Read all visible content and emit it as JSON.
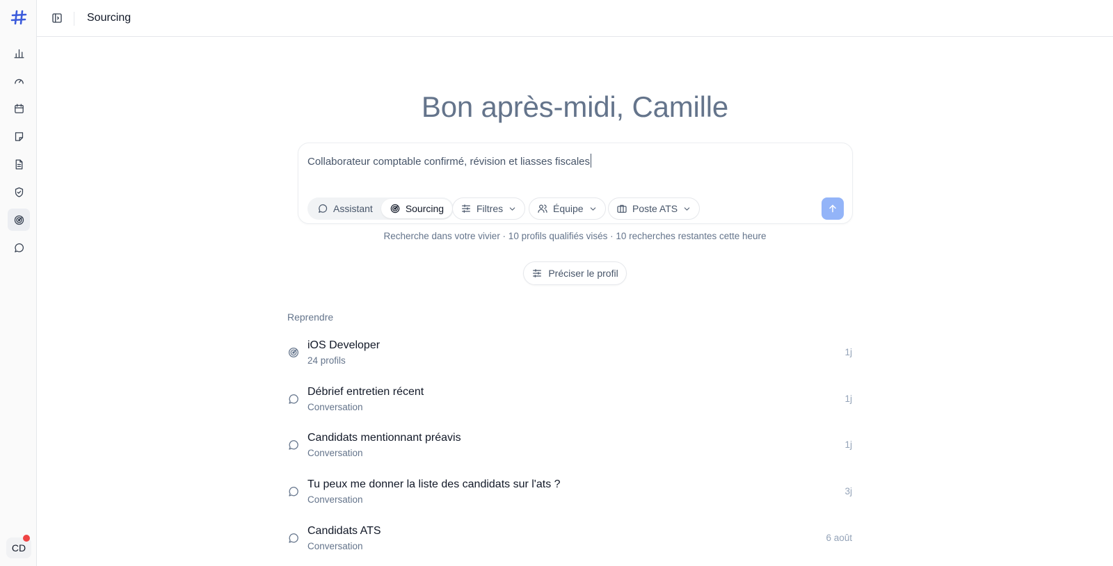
{
  "sidebar": {
    "logo": "hashtag-logo",
    "items": [
      {
        "name": "analytics",
        "icon": "bar-chart-icon"
      },
      {
        "name": "dashboard",
        "icon": "gauge-icon"
      },
      {
        "name": "calendar",
        "icon": "calendar-icon"
      },
      {
        "name": "notes",
        "icon": "sticky-note-icon"
      },
      {
        "name": "documents",
        "icon": "file-text-icon"
      },
      {
        "name": "security",
        "icon": "shield-check-icon"
      },
      {
        "name": "sourcing",
        "icon": "radar-icon",
        "active": true
      },
      {
        "name": "conversations",
        "icon": "message-circle-icon"
      }
    ],
    "user_initials": "CD",
    "notification_color": "#ef4444"
  },
  "header": {
    "title": "Sourcing"
  },
  "main": {
    "greeting": "Bon après-midi, Camille",
    "composer": {
      "query": "Collaborateur comptable confirmé, révision et liasses fiscales",
      "modes": [
        {
          "label": "Assistant",
          "icon": "message-circle-icon",
          "active": false
        },
        {
          "label": "Sourcing",
          "icon": "radar-icon",
          "active": true
        }
      ],
      "filters_label": "Filtres",
      "team_label": "Équipe",
      "ats_label": "Poste ATS",
      "send_color": "#93b4f8"
    },
    "info_line": "Recherche dans votre vivier · 10 profils qualifiés visés · 10 recherches restantes cette heure",
    "refine_label": "Préciser le profil",
    "recent_label": "Reprendre",
    "recent": [
      {
        "title": "iOS Developer",
        "subtitle": "24 profils",
        "time": "1j",
        "icon": "radar-icon"
      },
      {
        "title": "Débrief entretien récent",
        "subtitle": "Conversation",
        "time": "1j",
        "icon": "message-circle-icon"
      },
      {
        "title": "Candidats mentionnant préavis",
        "subtitle": "Conversation",
        "time": "1j",
        "icon": "message-circle-icon"
      },
      {
        "title": "Tu peux me donner la liste des candidats sur l'ats ?",
        "subtitle": "Conversation",
        "time": "3j",
        "icon": "message-circle-icon"
      },
      {
        "title": "Candidats ATS",
        "subtitle": "Conversation",
        "time": "6 août",
        "icon": "message-circle-icon"
      }
    ]
  }
}
